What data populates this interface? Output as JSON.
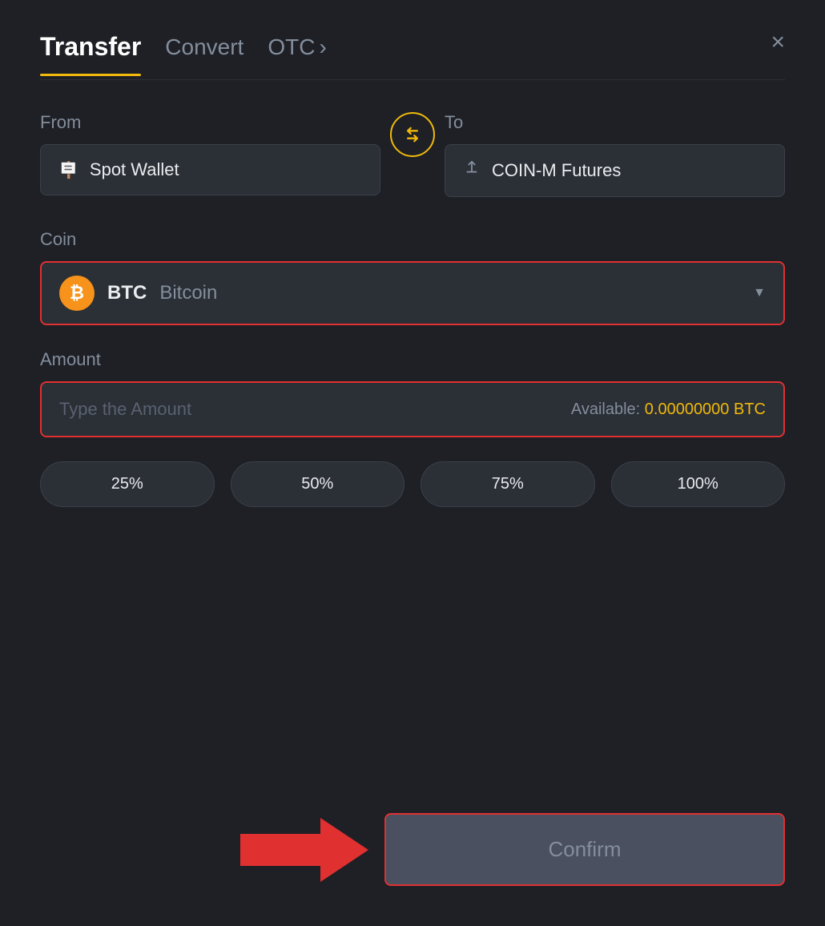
{
  "header": {
    "tab_transfer": "Transfer",
    "tab_convert": "Convert",
    "tab_otc": "OTC",
    "tab_otc_arrow": "›",
    "close_icon": "×"
  },
  "from": {
    "label": "From",
    "wallet_name": "Spot Wallet",
    "wallet_icon": "🪪"
  },
  "swap": {
    "icon": "⇄"
  },
  "to": {
    "label": "To",
    "wallet_name": "COIN-M Futures",
    "wallet_icon": "↑"
  },
  "coin": {
    "label": "Coin",
    "symbol": "BTC",
    "name": "Bitcoin",
    "dropdown_arrow": "▼"
  },
  "amount": {
    "label": "Amount",
    "placeholder": "Type the Amount",
    "available_label": "Available:",
    "available_value": "0.00000000 BTC"
  },
  "percentages": [
    {
      "label": "25%"
    },
    {
      "label": "50%"
    },
    {
      "label": "75%"
    },
    {
      "label": "100%"
    }
  ],
  "confirm_button": {
    "label": "Confirm"
  }
}
